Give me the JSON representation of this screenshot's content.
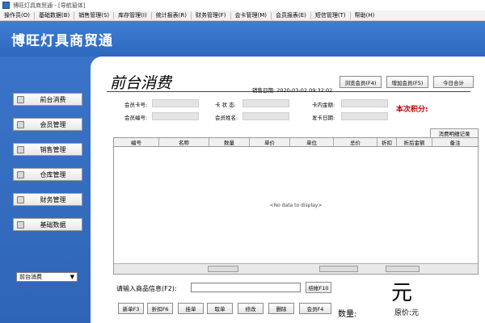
{
  "window": {
    "title": "博旺灯具商贸通 - [导航窗体]"
  },
  "menu": [
    "操作员(O)",
    "基础数据(B)",
    "销售管理(S)",
    "库存管理(I)",
    "统计报表(R)",
    "财务管理(F)",
    "会卡管理(M)",
    "会员报表(E)",
    "短信管理(T)",
    "帮助(H)"
  ],
  "brand": "博旺灯具商贸通",
  "nav": [
    "前台消费",
    "会员管理",
    "销售管理",
    "仓库管理",
    "财务管理",
    "基础数据"
  ],
  "nav_select": {
    "value": "前台消费"
  },
  "page_title": "前台消费",
  "sale_date": "销售日期: 2020-03-02 09:32:02",
  "top_buttons": [
    "浏览会员(F4)",
    "增加会员(F5)",
    "今日合计"
  ],
  "fields": {
    "card_no": "会员卡号:",
    "card_status": "卡 状 态:",
    "card_balance": "卡内金额:",
    "member_no": "会员编号:",
    "member_name": "会员姓名:",
    "issue_date": "发卡日期:"
  },
  "points_label": "本次积分:",
  "tab_label": "消费明细记录",
  "grid": {
    "columns": [
      "编号",
      "名称",
      "数量",
      "单价",
      "单位",
      "总价",
      "折扣",
      "折后金额",
      "备注"
    ],
    "empty_text": "<No data to display>"
  },
  "input": {
    "label": "请输入商品信息(F2):",
    "value": "",
    "button": "结帐F10"
  },
  "bottom_buttons": [
    "新单F3",
    "折扣F6",
    "挂单",
    "取单",
    "修改",
    "删除",
    "会员F4"
  ],
  "currency": "元",
  "qty_label": "数量:",
  "orig_label": "原价:元"
}
